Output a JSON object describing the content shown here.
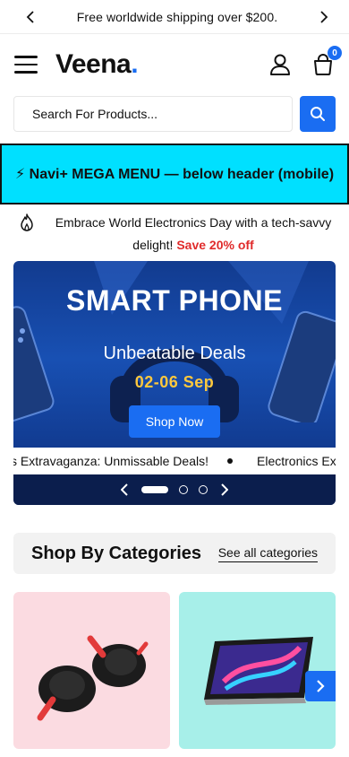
{
  "announcement": {
    "text": "Free worldwide shipping over $200."
  },
  "header": {
    "logo_text": "Veena",
    "logo_dot": ".",
    "cart_count": "0"
  },
  "search": {
    "placeholder": "Search For Products..."
  },
  "mega_menu": {
    "label": "⚡ Navi+ MEGA MENU — below header (mobile)"
  },
  "promo": {
    "text": "Embrace World Electronics Day with a tech-savvy delight!",
    "highlight": "Save 20% off"
  },
  "hero": {
    "title": "SMART PHONE",
    "subtitle": "Unbeatable Deals",
    "dates": "02-06 Sep",
    "button_label": "Shop Now",
    "ticker": [
      "s Extravaganza: Unmissable Deals!",
      "Electronics Ext"
    ],
    "slides_total": 3,
    "active_slide": 1
  },
  "categories": {
    "title": "Shop By Categories",
    "link_label": "See all categories"
  },
  "colors": {
    "accent": "#1a6df2",
    "sale": "#e02b2b",
    "mega_bg": "#00e0ff",
    "highlight_date": "#ffc83d"
  }
}
